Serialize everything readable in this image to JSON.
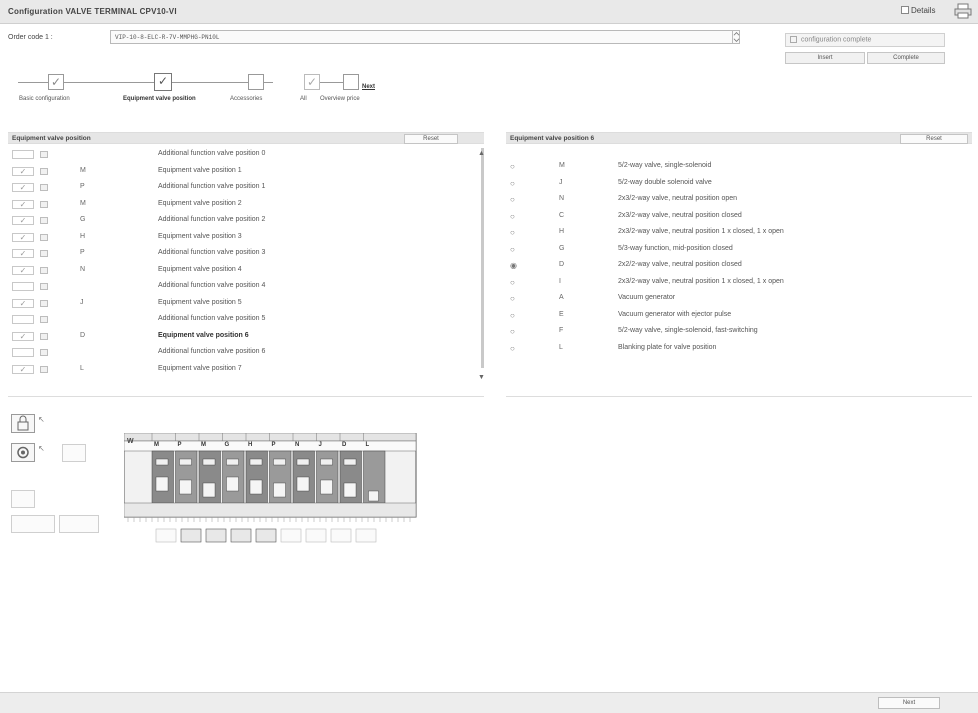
{
  "window": {
    "title": "Configuration VALVE TERMINAL CPV10-VI",
    "details_label": "Details",
    "print_icon": "print-icon"
  },
  "order": {
    "label": "Order code 1 :",
    "value": "VIP-10-8-ELC-R-7V-MMPHG-PN10L"
  },
  "status": {
    "config_complete_label": "configuration complete",
    "insert_label": "Insert",
    "complete_label": "Complete"
  },
  "wizard": {
    "steps": [
      {
        "label": "Basic configuration",
        "checked": true
      },
      {
        "label": "Equipment valve position",
        "checked": true,
        "active": true
      },
      {
        "label": "Accessories",
        "checked": false
      },
      {
        "label": "All",
        "checked": true
      },
      {
        "label": "Overview price",
        "checked": false
      }
    ],
    "next_label": "Next"
  },
  "left_panel": {
    "title": "Equipment valve position",
    "reset_label": "Reset",
    "rows": [
      {
        "checked": false,
        "code": "",
        "text": "Additional function valve position 0",
        "bold": false
      },
      {
        "checked": true,
        "code": "M",
        "text": "Equipment valve position 1",
        "bold": false
      },
      {
        "checked": true,
        "code": "P",
        "text": "Additional function valve position 1",
        "bold": false
      },
      {
        "checked": true,
        "code": "M",
        "text": "Equipment valve position 2",
        "bold": false
      },
      {
        "checked": true,
        "code": "G",
        "text": "Additional function valve position 2",
        "bold": false
      },
      {
        "checked": true,
        "code": "H",
        "text": "Equipment valve position 3",
        "bold": false
      },
      {
        "checked": true,
        "code": "P",
        "text": "Additional function valve position 3",
        "bold": false
      },
      {
        "checked": true,
        "code": "N",
        "text": "Equipment valve position 4",
        "bold": false
      },
      {
        "checked": false,
        "code": "",
        "text": "Additional function valve position 4",
        "bold": false
      },
      {
        "checked": true,
        "code": "J",
        "text": "Equipment valve position 5",
        "bold": false
      },
      {
        "checked": false,
        "code": "",
        "text": "Additional function valve position 5",
        "bold": false
      },
      {
        "checked": true,
        "code": "D",
        "text": "Equipment valve position 6",
        "bold": true
      },
      {
        "checked": false,
        "code": "",
        "text": "Additional function valve position 6",
        "bold": false
      },
      {
        "checked": true,
        "code": "L",
        "text": "Equipment valve position 7",
        "bold": false
      }
    ]
  },
  "right_panel": {
    "title": "Equipment valve position 6",
    "reset_label": "Reset",
    "options": [
      {
        "selected": false,
        "code": "M",
        "text": "5/2-way valve, single-solenoid"
      },
      {
        "selected": false,
        "code": "J",
        "text": "5/2-way double solenoid valve"
      },
      {
        "selected": false,
        "code": "N",
        "text": "2x3/2-way valve, neutral position open"
      },
      {
        "selected": false,
        "code": "C",
        "text": "2x3/2-way valve, neutral position closed"
      },
      {
        "selected": false,
        "code": "H",
        "text": "2x3/2-way valve, neutral position 1 x closed, 1 x open"
      },
      {
        "selected": false,
        "code": "G",
        "text": "5/3-way function, mid-position closed"
      },
      {
        "selected": true,
        "code": "D",
        "text": "2x2/2-way valve, neutral position closed"
      },
      {
        "selected": false,
        "code": "I",
        "text": "2x3/2-way valve, neutral position 1 x closed, 1 x open"
      },
      {
        "selected": false,
        "code": "A",
        "text": "Vacuum generator"
      },
      {
        "selected": false,
        "code": "E",
        "text": "Vacuum generator with ejector pulse"
      },
      {
        "selected": false,
        "code": "F",
        "text": "5/2-way valve, single-solenoid, fast-switching"
      },
      {
        "selected": false,
        "code": "L",
        "text": "Blanking plate for valve position"
      }
    ]
  },
  "diagram": {
    "header_letters": [
      "M",
      "P",
      "M",
      "G",
      "H",
      "P",
      "N",
      "J",
      "D",
      "L"
    ],
    "tail_letter": "W"
  },
  "footer": {
    "next_label": "Next"
  }
}
